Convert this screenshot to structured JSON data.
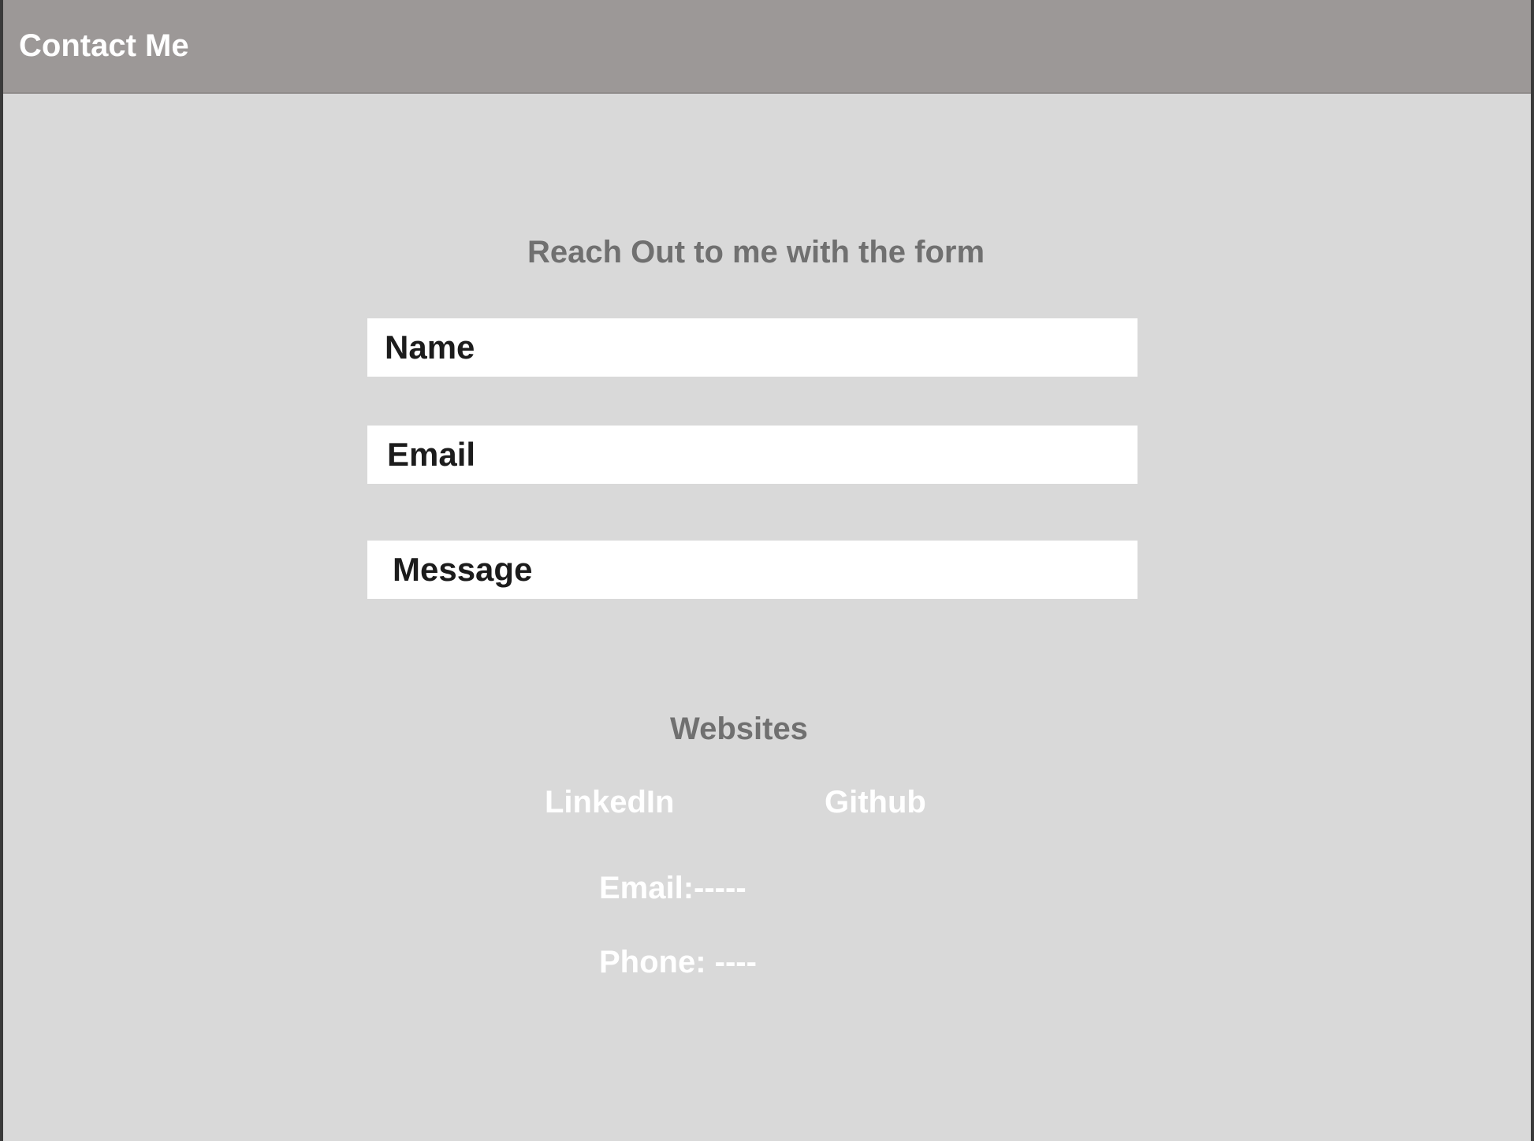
{
  "header": {
    "title": "Contact Me"
  },
  "form": {
    "heading": "Reach Out to me with the form",
    "fields": [
      {
        "label": "Name"
      },
      {
        "label": "Email"
      },
      {
        "label": "Message"
      }
    ]
  },
  "websites": {
    "title": "Websites",
    "links": [
      {
        "label": "LinkedIn"
      },
      {
        "label": "Github"
      }
    ]
  },
  "contact": {
    "email": "Email:-----",
    "phone": "Phone: ----"
  },
  "colors": {
    "header_bg": "#9c9897",
    "page_bg": "#d9d9d9",
    "heading_text": "#707070",
    "field_bg": "#ffffff",
    "field_text": "#1c1c1c",
    "light_text": "#ffffff"
  }
}
